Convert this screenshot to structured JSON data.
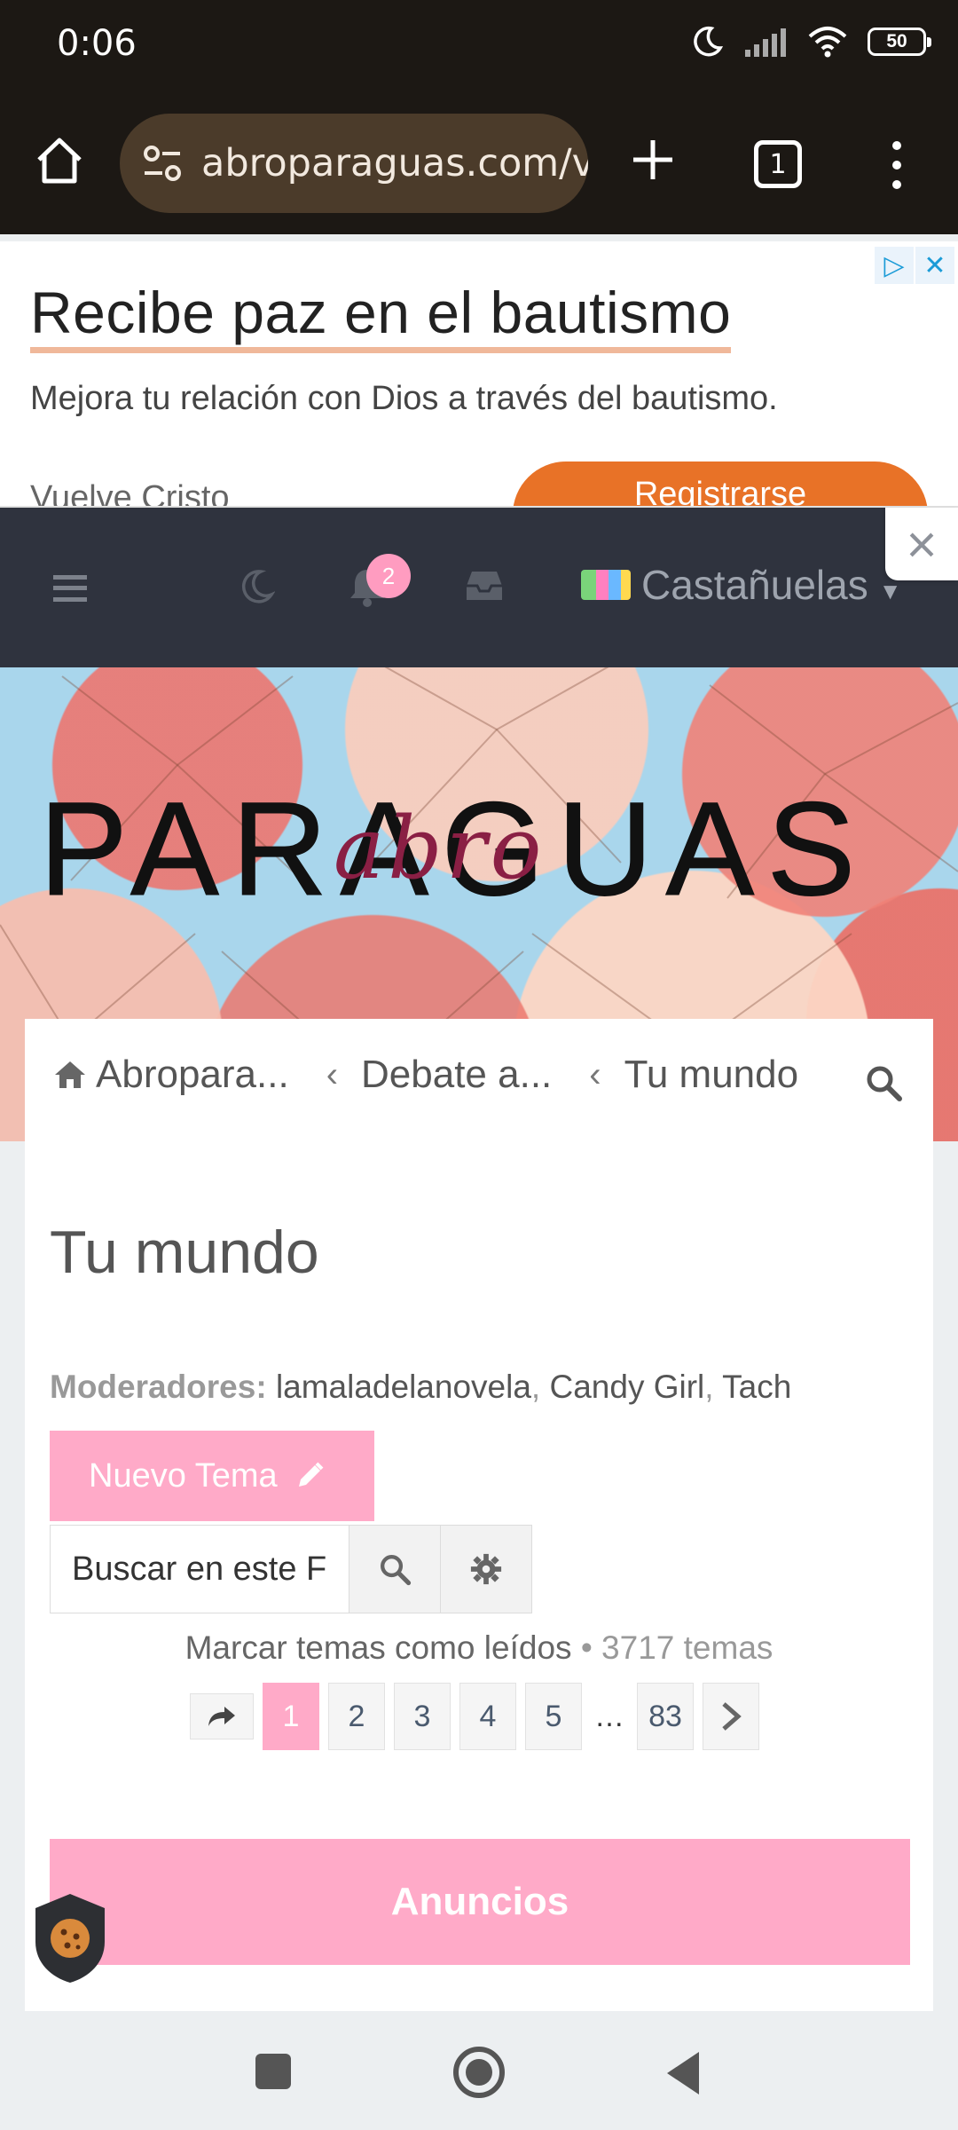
{
  "status_bar": {
    "time": "0:06",
    "battery": "50"
  },
  "browser": {
    "url": "abroparaguas.com/v",
    "tab_count": "1"
  },
  "ad": {
    "headline": "Recibe paz en el bautismo",
    "body": "Mejora tu relación con Dios a través del bautismo.",
    "advertiser_partial": "Vuelve Cristo",
    "cta_label": "Registrarse"
  },
  "forum_nav": {
    "notification_count": "2",
    "username": "Castañuelas"
  },
  "header": {
    "logo_text": "PARAGUAS",
    "logo_script": "abro"
  },
  "breadcrumb": {
    "items": [
      "Abropara...",
      "Debate a...",
      "Tu mundo"
    ]
  },
  "forum": {
    "title": "Tu mundo",
    "moderators_label": "Moderadores:",
    "moderators": [
      "lamaladelanovela",
      "Candy Girl",
      "Tach"
    ],
    "new_topic_label": "Nuevo Tema",
    "search_placeholder": "Buscar en este Foro…",
    "search_value": "Buscar en este F",
    "mark_read_label": "Marcar temas como leídos",
    "topics_count": "3717 temas",
    "announcements_label": "Anuncios"
  },
  "pagination": {
    "pages": [
      "1",
      "2",
      "3",
      "4",
      "5"
    ],
    "ellipsis": "…",
    "last_page": "83",
    "current_page": 1
  },
  "colors": {
    "accent_pink": "#ffaac8",
    "nav_dark": "#2f333e",
    "browser_dark": "#1c1814",
    "ad_cta": "#e87227"
  }
}
